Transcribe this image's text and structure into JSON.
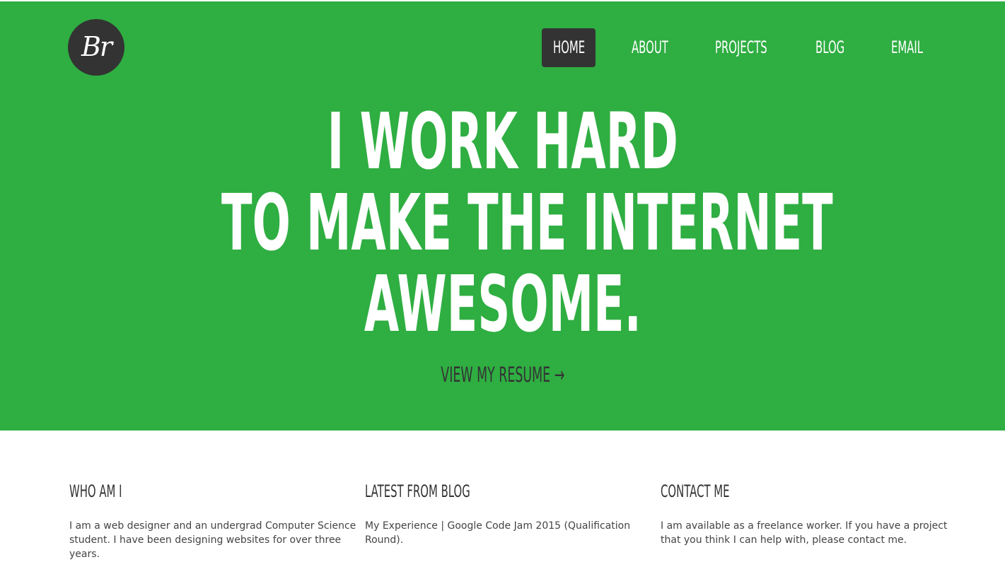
{
  "hero": {
    "logo_text": "Br",
    "nav": [
      "HOME",
      "ABOUT",
      "PROJECTS",
      "BLOG",
      "EMAIL"
    ],
    "active_nav": "HOME",
    "headline_lines": [
      "I WORK HARD",
      "TO MAKE THE INTERNET",
      "AWESOME."
    ],
    "cta_label": "VIEW MY RESUME →",
    "background_color": "#2fae42"
  },
  "sections": [
    {
      "title": "WHO AM I",
      "body": "I am a web designer and an undergrad Computer Science student. I have been designing websites for over three years."
    },
    {
      "title": "LATEST FROM BLOG",
      "body": "My Experience | Google Code Jam 2015 (Qualification Round)."
    },
    {
      "title": "CONTACT ME",
      "body": "I am available as a freelance worker. If you have a project that you think I can help with, please contact me."
    }
  ]
}
